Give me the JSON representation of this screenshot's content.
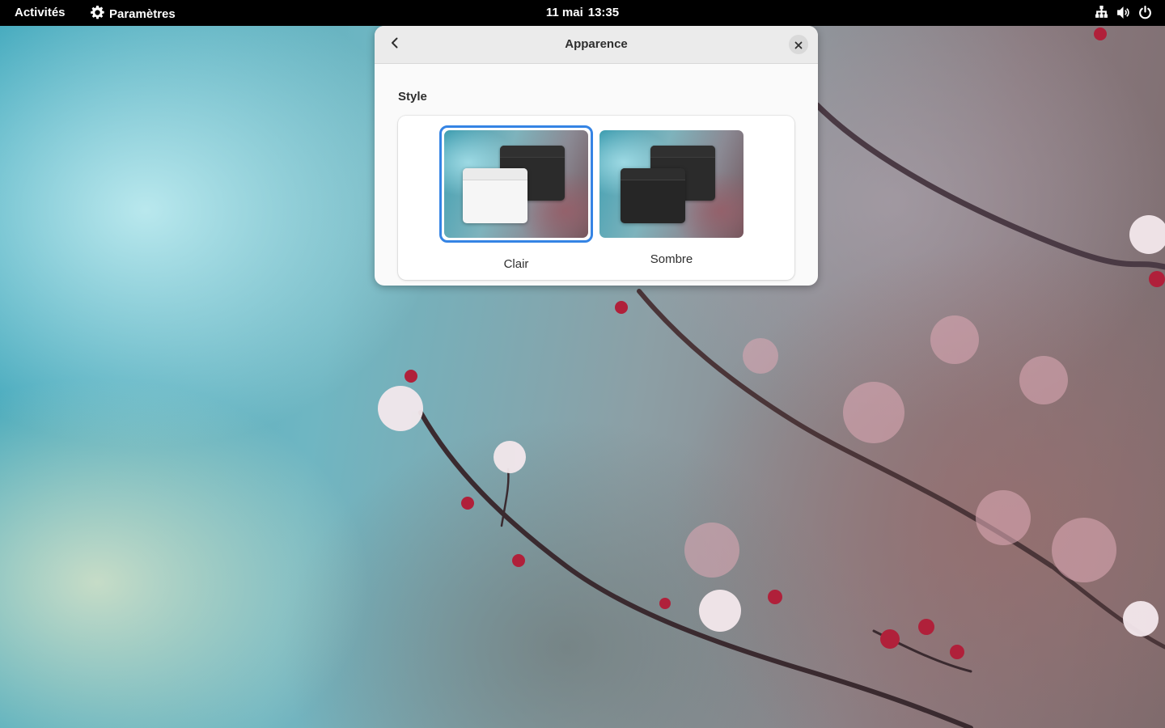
{
  "topbar": {
    "activities": "Activités",
    "app_name": "Paramètres",
    "date": "11 mai",
    "time": "13:35",
    "tray_icons": [
      "network-icon",
      "volume-icon",
      "power-icon"
    ]
  },
  "window": {
    "title": "Apparence",
    "section_label": "Style",
    "options": [
      {
        "label": "Clair",
        "selected": true
      },
      {
        "label": "Sombre",
        "selected": false
      }
    ]
  },
  "colors": {
    "accent": "#3584e4",
    "topbar": "#000000",
    "window_bg": "#fafafa"
  }
}
